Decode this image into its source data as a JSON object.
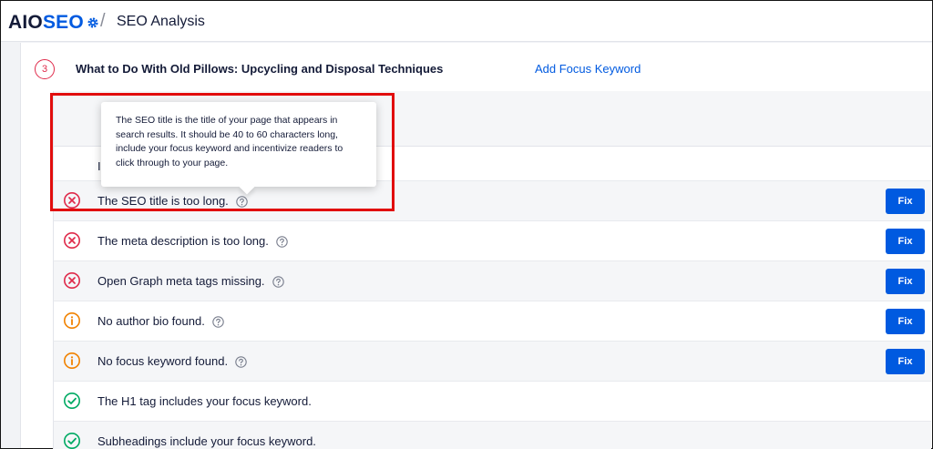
{
  "header": {
    "logo_aio": "AIO",
    "logo_seo": "SEO",
    "separator": "/",
    "breadcrumb": "SEO Analysis"
  },
  "analysis": {
    "step_number": "3",
    "post_title": "What to Do With Old Pillows: Upcycling and Disposal Techniques",
    "add_keyword_label": "Add Focus Keyword",
    "section_label_partial": "I"
  },
  "tooltip": {
    "text": "The SEO title is the title of your page that appears in search results. It should be 40 to 60 characters long, include your focus keyword and incentivize readers to click through to your page."
  },
  "checks": [
    {
      "status": "error",
      "icon": "error-x-icon",
      "text": "The SEO title is too long.",
      "has_help": true,
      "fix_label": "Fix"
    },
    {
      "status": "error",
      "icon": "error-x-icon",
      "text": "The meta description is too long.",
      "has_help": true,
      "fix_label": "Fix"
    },
    {
      "status": "error",
      "icon": "error-x-icon",
      "text": "Open Graph meta tags missing.",
      "has_help": true,
      "fix_label": "Fix"
    },
    {
      "status": "warning",
      "icon": "info-warning-icon",
      "text": "No author bio found.",
      "has_help": true,
      "fix_label": "Fix"
    },
    {
      "status": "warning",
      "icon": "info-warning-icon",
      "text": "No focus keyword found.",
      "has_help": true,
      "fix_label": "Fix"
    },
    {
      "status": "success",
      "icon": "checkmark-icon",
      "text": "The H1 tag includes your focus keyword.",
      "has_help": false,
      "fix_label": ""
    },
    {
      "status": "success",
      "icon": "checkmark-icon",
      "text": "Subheadings include your focus keyword.",
      "has_help": false,
      "fix_label": ""
    }
  ],
  "colors": {
    "brand_blue": "#005ae0",
    "error_red": "#df2a4a",
    "warning_orange": "#f18200",
    "success_green": "#00aa63",
    "highlight_red": "#e10d0d"
  }
}
